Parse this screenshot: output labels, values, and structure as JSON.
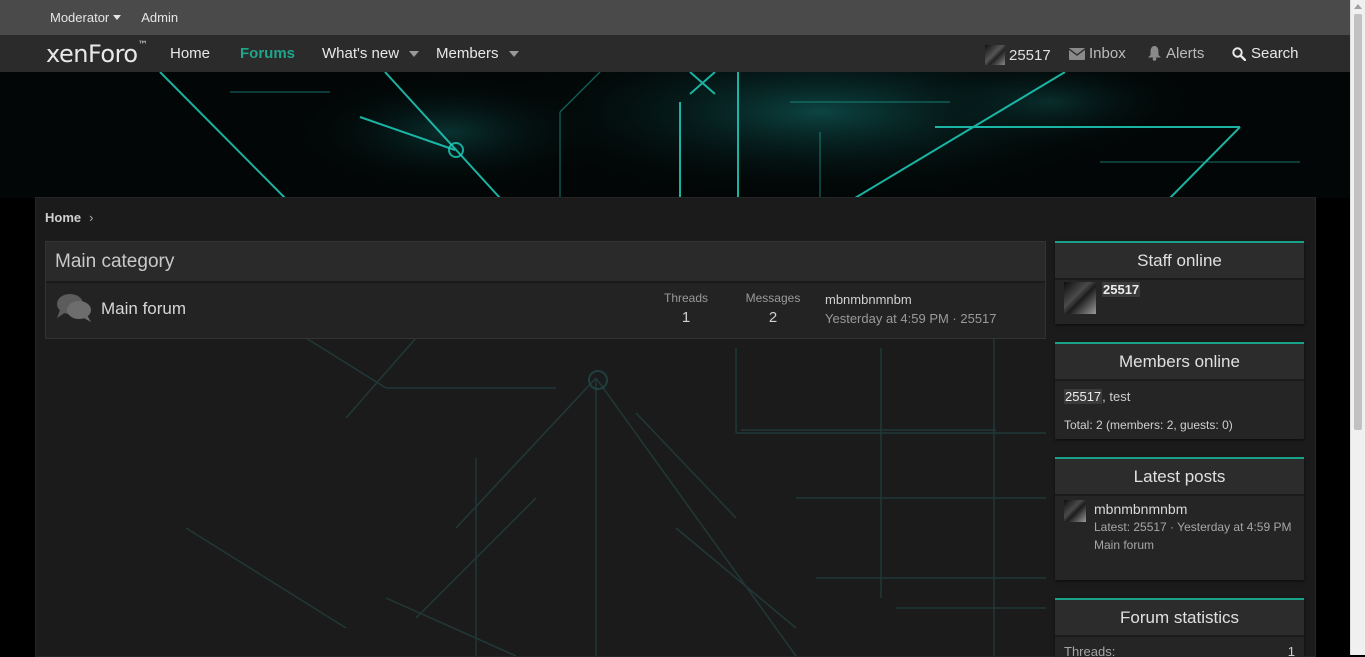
{
  "staffbar": {
    "moderator": "Moderator",
    "admin": "Admin"
  },
  "navbar": {
    "logo": "xenForo",
    "logo_mark": "™",
    "tabs": {
      "home": "Home",
      "forums": "Forums",
      "whats_new": "What's new",
      "members": "Members"
    },
    "user": "25517",
    "inbox": "Inbox",
    "alerts": "Alerts",
    "search": "Search"
  },
  "breadcrumb": {
    "home": "Home",
    "chevron": "›"
  },
  "category": {
    "title": "Main category",
    "forum": {
      "title": "Main forum",
      "threads_label": "Threads",
      "threads_value": "1",
      "messages_label": "Messages",
      "messages_value": "2",
      "last_post_title": "mbnmbnmnbm",
      "last_post_meta": "Yesterday at 4:59 PM · 25517"
    }
  },
  "sidebar": {
    "staff_online": {
      "title": "Staff online",
      "user": "25517"
    },
    "members_online": {
      "title": "Members online",
      "user1": "25517",
      "separator": ", ",
      "user2": "test",
      "total": "Total: 2 (members: 2, guests: 0)"
    },
    "latest_posts": {
      "title": "Latest posts",
      "post_title": "mbnmbnmnbm",
      "meta": "Latest: 25517 · Yesterday at 4:59 PM",
      "forum": "Main forum"
    },
    "forum_statistics": {
      "title": "Forum statistics",
      "threads_label": "Threads:",
      "threads_value": "1"
    }
  },
  "colors": {
    "accent": "#1fa58a",
    "staffbar": "#4a4a4a",
    "navbar": "#2b2b2b",
    "content": "#1b1b1c",
    "block_border": "#17a289"
  }
}
